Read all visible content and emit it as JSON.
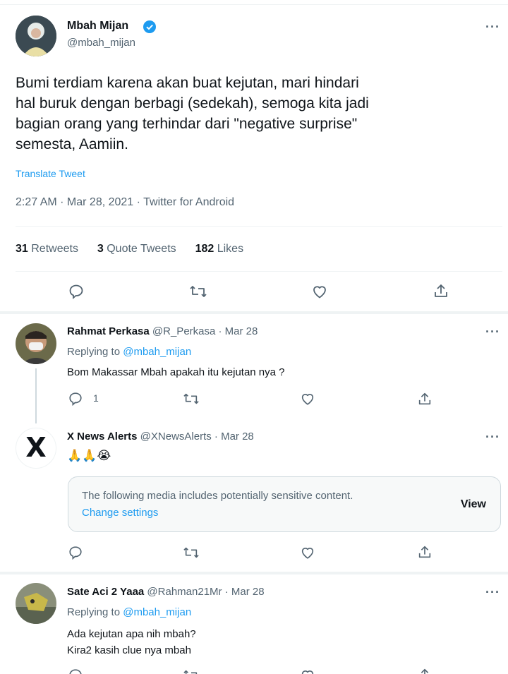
{
  "main_tweet": {
    "name": "Mbah Mijan",
    "handle": "@mbah_mijan",
    "text_lines": [
      "Bumi terdiam karena akan buat kejutan, mari hindari",
      "hal buruk dengan berbagi (sedekah), semoga kita jadi",
      "bagian orang yang terhindar dari \"negative surprise\"",
      "semesta, Aamiin."
    ],
    "translate": "Translate Tweet",
    "meta": "2:27 AM · Mar 28, 2021 · Twitter for Android",
    "stats": {
      "retweets_count": "31",
      "retweets_label": "Retweets",
      "quotes_count": "3",
      "quotes_label": "Quote Tweets",
      "likes_count": "182",
      "likes_label": "Likes"
    },
    "more": "···"
  },
  "replies": [
    {
      "name": "Rahmat Perkasa",
      "handle_date": "@R_Perkasa · Mar 28",
      "replying_prefix": "Replying to",
      "replying_to": "@mbah_mijan",
      "text": "Bom Makassar Mbah apakah itu kejutan nya ?",
      "reply_count": "1",
      "more": "···"
    },
    {
      "name": "X News Alerts",
      "handle_date": "@XNewsAlerts · Mar 28",
      "text": "🙏🙏😭",
      "avatar_letter": "X",
      "sensitive_notice": "The following media includes potentially sensitive content.",
      "change_settings": "Change settings",
      "view": "View",
      "more": "···"
    },
    {
      "name": "Sate Aci 2 Yaaa",
      "handle_date": "@Rahman21Mr · Mar 28",
      "replying_prefix": "Replying to",
      "replying_to": "@mbah_mijan",
      "text_lines": [
        "Ada kejutan apa nih mbah?",
        "Kira2 kasih clue nya mbah"
      ],
      "more": "···"
    }
  ],
  "colors": {
    "accent": "#1d9bf0",
    "text": "#0f1419",
    "secondary": "#536471",
    "divider": "#eff3f4",
    "section_bg": "#f7f9f9"
  }
}
